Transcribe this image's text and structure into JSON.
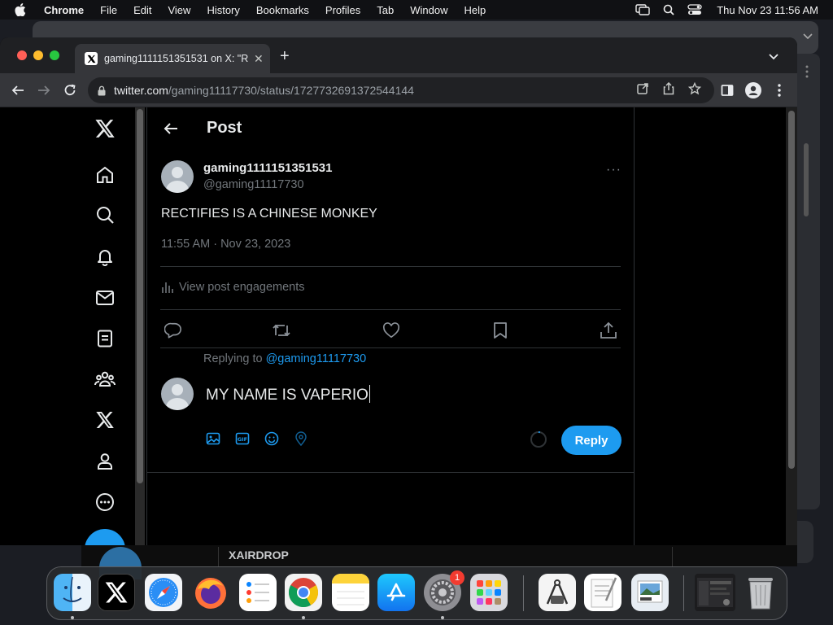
{
  "menubar": {
    "app_name": "Chrome",
    "items": [
      "File",
      "Edit",
      "View",
      "History",
      "Bookmarks",
      "Profiles",
      "Tab",
      "Window",
      "Help"
    ],
    "clock": "Thu Nov 23  11:56 AM",
    "icons": [
      "apple-icon",
      "screen-mirroring-icon",
      "spotlight-search-icon",
      "control-center-icon"
    ]
  },
  "browser": {
    "tab_title": "gaming1111151351531 on X: \"R",
    "url_host": "twitter.com",
    "url_path": "/gaming11117730/status/1727732691372544144"
  },
  "post": {
    "header_title": "Post",
    "author_name": "gaming1111151351531",
    "author_handle": "@gaming11117730",
    "more": "···",
    "text": "RECTIFIES IS A CHINESE MONKEY",
    "timestamp": "11:55 AM · Nov 23, 2023",
    "engagements_label": "View post engagements"
  },
  "reply": {
    "replying_prefix": "Replying to",
    "replying_handle": "@gaming11117730",
    "draft_text": "MY NAME IS VAPERIO",
    "reply_button": "Reply"
  },
  "background_window": {
    "visible_text": "XAIRDROP"
  },
  "dock": {
    "apps": [
      "Finder",
      "X",
      "Safari",
      "Firefox",
      "Reminders",
      "Chrome",
      "Notes",
      "App Store",
      "System Settings",
      "Launchpad",
      "Instruments",
      "TextEdit",
      "Preview",
      "Window Thumbnail",
      "Trash"
    ],
    "settings_badge": "1"
  },
  "colors": {
    "accent": "#1d9bf0",
    "background": "#000000",
    "text": "#e7e9ea",
    "muted": "#71767b",
    "divider": "#2f3336"
  }
}
